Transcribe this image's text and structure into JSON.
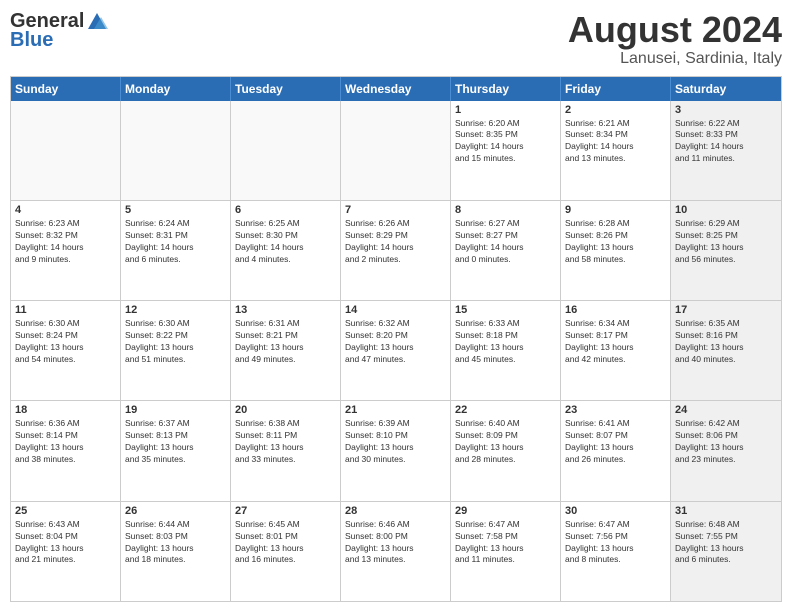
{
  "header": {
    "logo_general": "General",
    "logo_blue": "Blue",
    "month_title": "August 2024",
    "location": "Lanusei, Sardinia, Italy"
  },
  "days_of_week": [
    "Sunday",
    "Monday",
    "Tuesday",
    "Wednesday",
    "Thursday",
    "Friday",
    "Saturday"
  ],
  "rows": [
    [
      {
        "day": "",
        "info": "",
        "empty": true
      },
      {
        "day": "",
        "info": "",
        "empty": true
      },
      {
        "day": "",
        "info": "",
        "empty": true
      },
      {
        "day": "",
        "info": "",
        "empty": true
      },
      {
        "day": "1",
        "info": "Sunrise: 6:20 AM\nSunset: 8:35 PM\nDaylight: 14 hours\nand 15 minutes.",
        "empty": false
      },
      {
        "day": "2",
        "info": "Sunrise: 6:21 AM\nSunset: 8:34 PM\nDaylight: 14 hours\nand 13 minutes.",
        "empty": false
      },
      {
        "day": "3",
        "info": "Sunrise: 6:22 AM\nSunset: 8:33 PM\nDaylight: 14 hours\nand 11 minutes.",
        "empty": false,
        "shaded": true
      }
    ],
    [
      {
        "day": "4",
        "info": "Sunrise: 6:23 AM\nSunset: 8:32 PM\nDaylight: 14 hours\nand 9 minutes.",
        "empty": false
      },
      {
        "day": "5",
        "info": "Sunrise: 6:24 AM\nSunset: 8:31 PM\nDaylight: 14 hours\nand 6 minutes.",
        "empty": false
      },
      {
        "day": "6",
        "info": "Sunrise: 6:25 AM\nSunset: 8:30 PM\nDaylight: 14 hours\nand 4 minutes.",
        "empty": false
      },
      {
        "day": "7",
        "info": "Sunrise: 6:26 AM\nSunset: 8:29 PM\nDaylight: 14 hours\nand 2 minutes.",
        "empty": false
      },
      {
        "day": "8",
        "info": "Sunrise: 6:27 AM\nSunset: 8:27 PM\nDaylight: 14 hours\nand 0 minutes.",
        "empty": false
      },
      {
        "day": "9",
        "info": "Sunrise: 6:28 AM\nSunset: 8:26 PM\nDaylight: 13 hours\nand 58 minutes.",
        "empty": false
      },
      {
        "day": "10",
        "info": "Sunrise: 6:29 AM\nSunset: 8:25 PM\nDaylight: 13 hours\nand 56 minutes.",
        "empty": false,
        "shaded": true
      }
    ],
    [
      {
        "day": "11",
        "info": "Sunrise: 6:30 AM\nSunset: 8:24 PM\nDaylight: 13 hours\nand 54 minutes.",
        "empty": false
      },
      {
        "day": "12",
        "info": "Sunrise: 6:30 AM\nSunset: 8:22 PM\nDaylight: 13 hours\nand 51 minutes.",
        "empty": false
      },
      {
        "day": "13",
        "info": "Sunrise: 6:31 AM\nSunset: 8:21 PM\nDaylight: 13 hours\nand 49 minutes.",
        "empty": false
      },
      {
        "day": "14",
        "info": "Sunrise: 6:32 AM\nSunset: 8:20 PM\nDaylight: 13 hours\nand 47 minutes.",
        "empty": false
      },
      {
        "day": "15",
        "info": "Sunrise: 6:33 AM\nSunset: 8:18 PM\nDaylight: 13 hours\nand 45 minutes.",
        "empty": false
      },
      {
        "day": "16",
        "info": "Sunrise: 6:34 AM\nSunset: 8:17 PM\nDaylight: 13 hours\nand 42 minutes.",
        "empty": false
      },
      {
        "day": "17",
        "info": "Sunrise: 6:35 AM\nSunset: 8:16 PM\nDaylight: 13 hours\nand 40 minutes.",
        "empty": false,
        "shaded": true
      }
    ],
    [
      {
        "day": "18",
        "info": "Sunrise: 6:36 AM\nSunset: 8:14 PM\nDaylight: 13 hours\nand 38 minutes.",
        "empty": false
      },
      {
        "day": "19",
        "info": "Sunrise: 6:37 AM\nSunset: 8:13 PM\nDaylight: 13 hours\nand 35 minutes.",
        "empty": false
      },
      {
        "day": "20",
        "info": "Sunrise: 6:38 AM\nSunset: 8:11 PM\nDaylight: 13 hours\nand 33 minutes.",
        "empty": false
      },
      {
        "day": "21",
        "info": "Sunrise: 6:39 AM\nSunset: 8:10 PM\nDaylight: 13 hours\nand 30 minutes.",
        "empty": false
      },
      {
        "day": "22",
        "info": "Sunrise: 6:40 AM\nSunset: 8:09 PM\nDaylight: 13 hours\nand 28 minutes.",
        "empty": false
      },
      {
        "day": "23",
        "info": "Sunrise: 6:41 AM\nSunset: 8:07 PM\nDaylight: 13 hours\nand 26 minutes.",
        "empty": false
      },
      {
        "day": "24",
        "info": "Sunrise: 6:42 AM\nSunset: 8:06 PM\nDaylight: 13 hours\nand 23 minutes.",
        "empty": false,
        "shaded": true
      }
    ],
    [
      {
        "day": "25",
        "info": "Sunrise: 6:43 AM\nSunset: 8:04 PM\nDaylight: 13 hours\nand 21 minutes.",
        "empty": false
      },
      {
        "day": "26",
        "info": "Sunrise: 6:44 AM\nSunset: 8:03 PM\nDaylight: 13 hours\nand 18 minutes.",
        "empty": false
      },
      {
        "day": "27",
        "info": "Sunrise: 6:45 AM\nSunset: 8:01 PM\nDaylight: 13 hours\nand 16 minutes.",
        "empty": false
      },
      {
        "day": "28",
        "info": "Sunrise: 6:46 AM\nSunset: 8:00 PM\nDaylight: 13 hours\nand 13 minutes.",
        "empty": false
      },
      {
        "day": "29",
        "info": "Sunrise: 6:47 AM\nSunset: 7:58 PM\nDaylight: 13 hours\nand 11 minutes.",
        "empty": false
      },
      {
        "day": "30",
        "info": "Sunrise: 6:47 AM\nSunset: 7:56 PM\nDaylight: 13 hours\nand 8 minutes.",
        "empty": false
      },
      {
        "day": "31",
        "info": "Sunrise: 6:48 AM\nSunset: 7:55 PM\nDaylight: 13 hours\nand 6 minutes.",
        "empty": false,
        "shaded": true
      }
    ]
  ]
}
